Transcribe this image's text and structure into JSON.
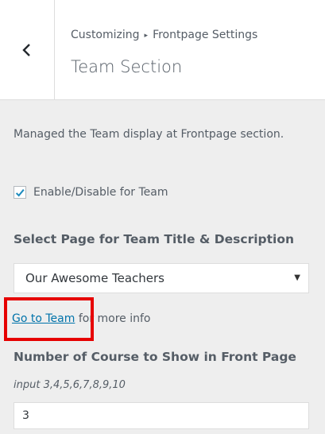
{
  "header": {
    "breadcrumb_root": "Customizing",
    "breadcrumb_separator": "▸",
    "breadcrumb_parent": "Frontpage Settings",
    "title": "Team Section",
    "back_icon": "chevron-left-icon"
  },
  "section": {
    "description": "Managed the Team display at Frontpage section.",
    "enable_label": "Enable/Disable for Team",
    "enable_checked": true,
    "select_title": "Select Page for Team Title & Description",
    "select_value": "Our Awesome Teachers",
    "link_text": "Go to Team",
    "link_suffix": " for more info",
    "count_title": "Number of Course to Show in Front Page",
    "count_hint": "input 3,4,5,6,7,8,9,10",
    "count_value": "3"
  },
  "colors": {
    "link": "#0073aa",
    "checkmark": "#1e8cbe",
    "highlight": "#e60000"
  }
}
